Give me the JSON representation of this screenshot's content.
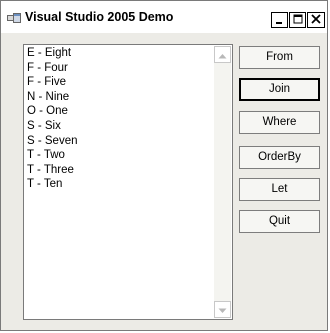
{
  "window": {
    "title": "Visual Studio 2005 Demo",
    "icon": "form-app-icon",
    "controls": [
      "minimize-icon",
      "maximize-icon",
      "close-icon"
    ]
  },
  "listbox": {
    "items": [
      "E - Eight",
      "F - Four",
      "F - Five",
      "N - Nine",
      "O - One",
      "S - Six",
      "S - Seven",
      "T - Two",
      "T - Three",
      "T - Ten"
    ]
  },
  "buttons": {
    "from": "From",
    "join": "Join",
    "where": "Where",
    "orderby": "OrderBy",
    "let": "Let",
    "quit": "Quit"
  }
}
